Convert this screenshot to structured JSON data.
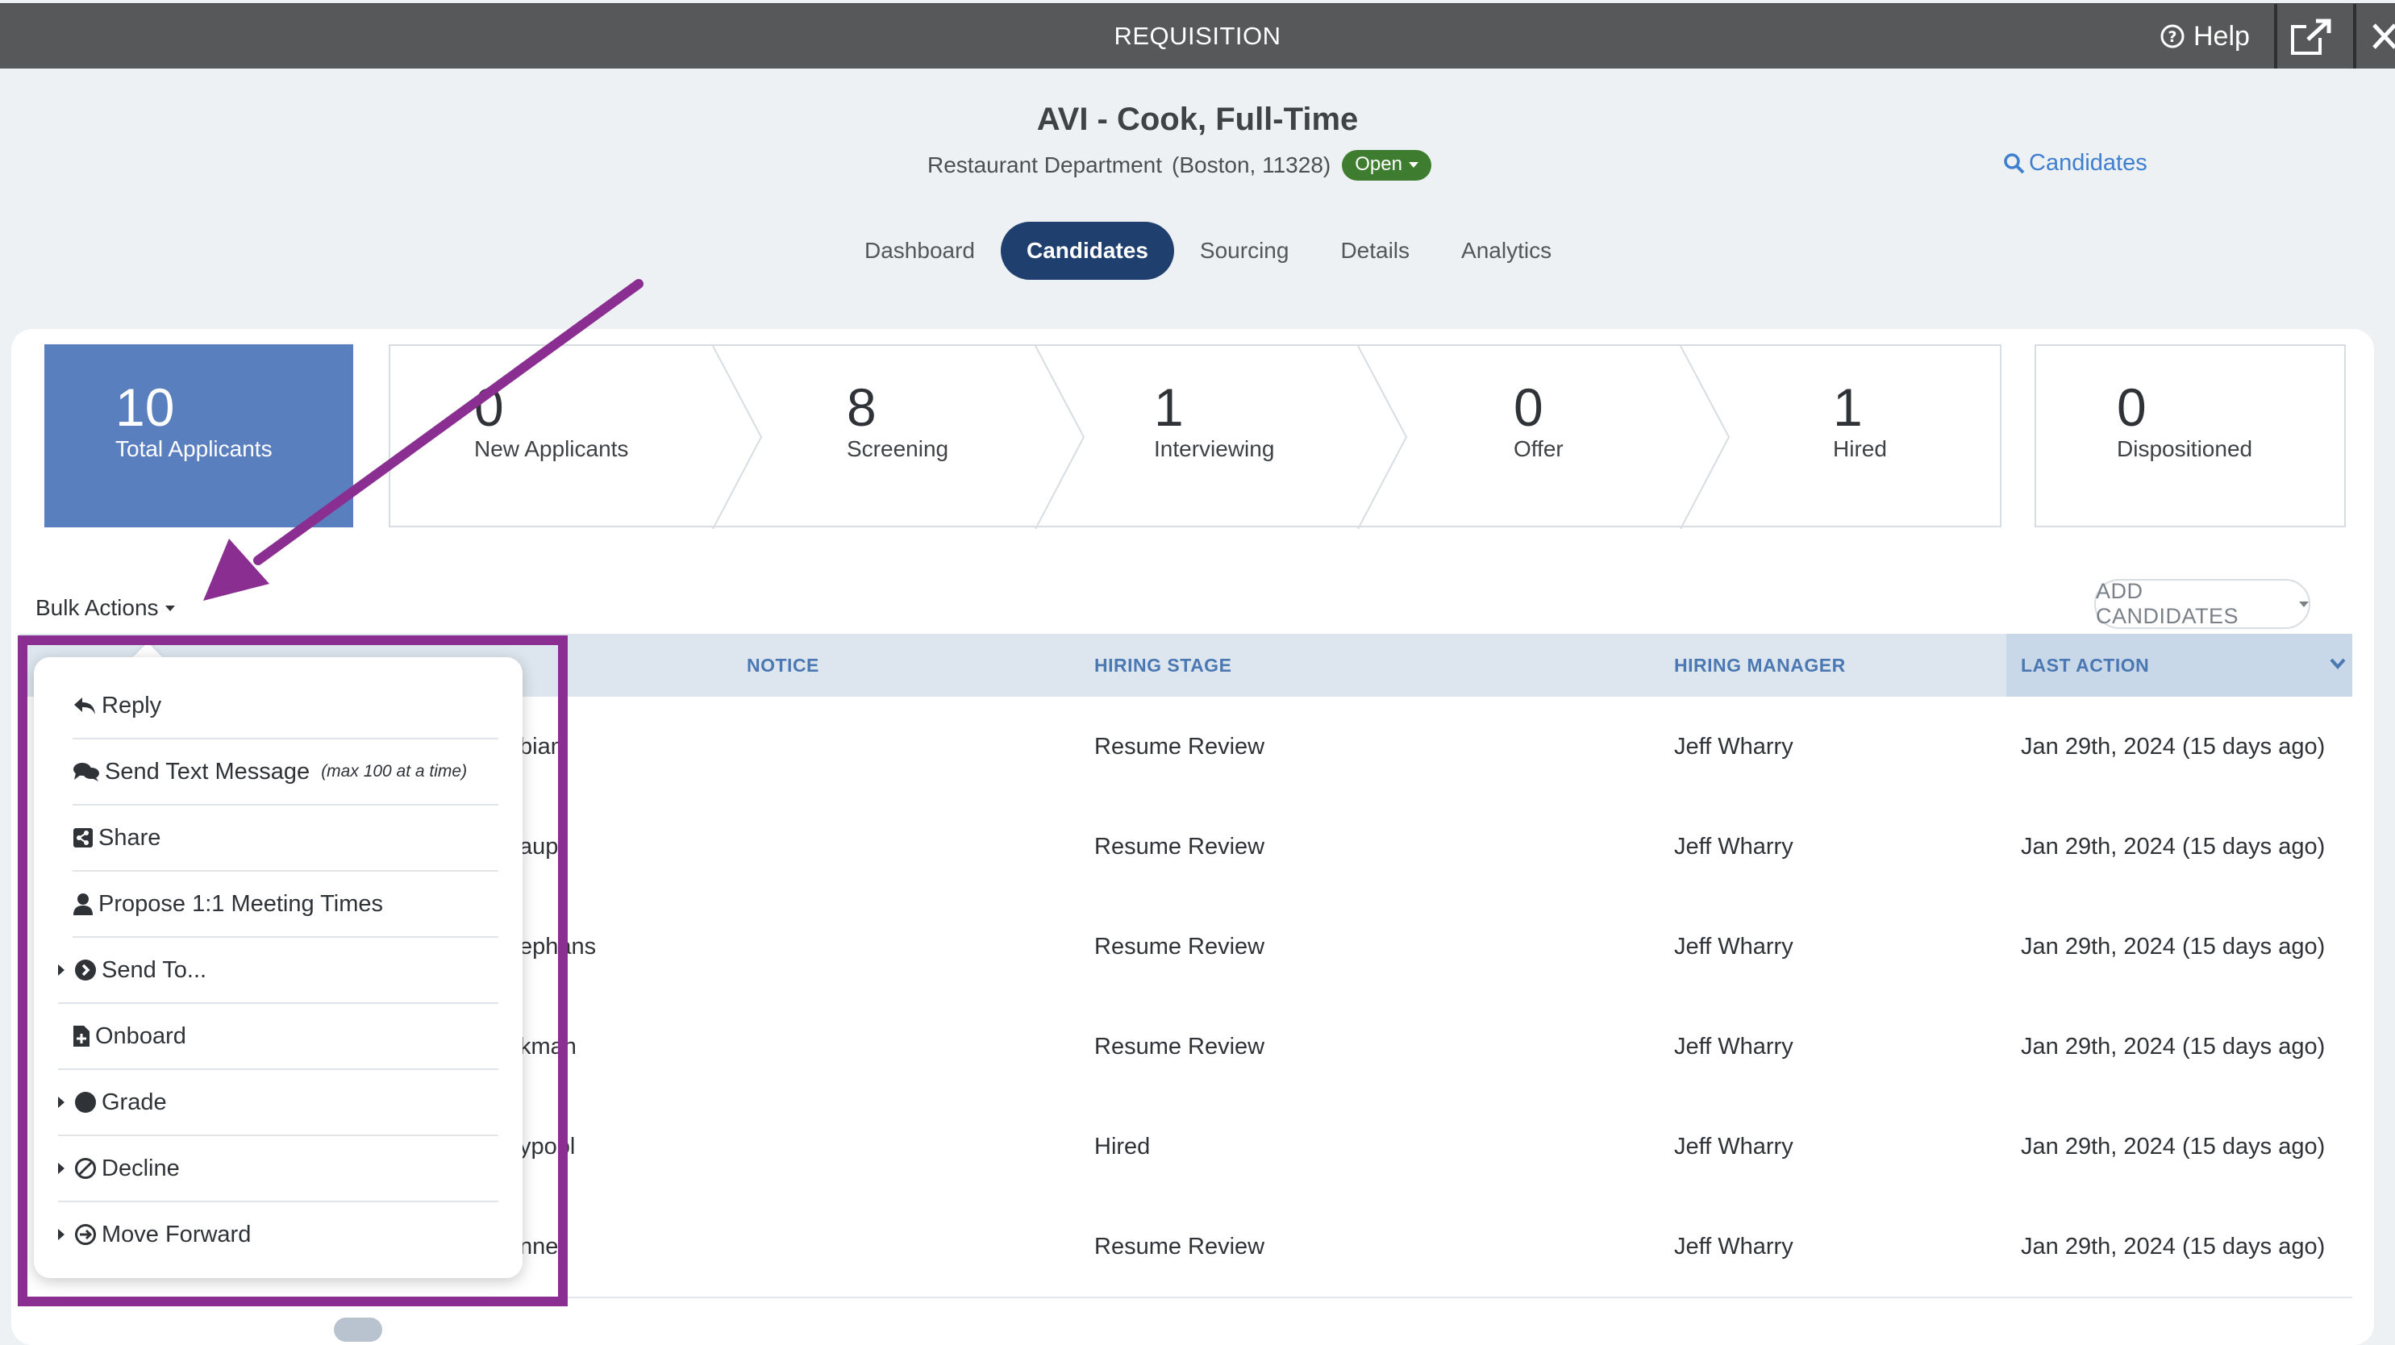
{
  "topbar": {
    "title": "REQUISITION",
    "help_label": "Help"
  },
  "requisition": {
    "title": "AVI - Cook, Full-Time",
    "department": "Restaurant Department",
    "location": "(Boston, 11328)",
    "status": "Open",
    "candidates_link": "Candidates"
  },
  "tabs": [
    {
      "label": "Dashboard",
      "active": false
    },
    {
      "label": "Candidates",
      "active": true
    },
    {
      "label": "Sourcing",
      "active": false
    },
    {
      "label": "Details",
      "active": false
    },
    {
      "label": "Analytics",
      "active": false
    }
  ],
  "summary": {
    "total": {
      "count": "10",
      "label": "Total Applicants"
    },
    "stages": [
      {
        "count": "0",
        "label": "New Applicants"
      },
      {
        "count": "8",
        "label": "Screening"
      },
      {
        "count": "1",
        "label": "Interviewing"
      },
      {
        "count": "0",
        "label": "Offer"
      },
      {
        "count": "1",
        "label": "Hired"
      }
    ],
    "dispositioned": {
      "count": "0",
      "label": "Dispositioned"
    }
  },
  "toolbar": {
    "bulk_actions_label": "Bulk Actions",
    "add_candidates_label": "ADD CANDIDATES"
  },
  "table": {
    "headers": {
      "notice": "NOTICE",
      "hiring_stage": "HIRING STAGE",
      "hiring_manager": "HIRING MANAGER",
      "last_action": "LAST ACTION"
    },
    "rows": [
      {
        "name_fragment": "bian",
        "stage": "Resume Review",
        "manager": "Jeff Wharry",
        "last_action": "Jan 29th, 2024 (15 days ago)"
      },
      {
        "name_fragment": "aupt",
        "stage": "Resume Review",
        "manager": "Jeff Wharry",
        "last_action": "Jan 29th, 2024 (15 days ago)"
      },
      {
        "name_fragment": "ephans",
        "stage": "Resume Review",
        "manager": "Jeff Wharry",
        "last_action": "Jan 29th, 2024 (15 days ago)"
      },
      {
        "name_fragment": "kman",
        "stage": "Resume Review",
        "manager": "Jeff Wharry",
        "last_action": "Jan 29th, 2024 (15 days ago)"
      },
      {
        "name_fragment": "ypool",
        "stage": "Hired",
        "manager": "Jeff Wharry",
        "last_action": "Jan 29th, 2024 (15 days ago)"
      },
      {
        "name_fragment": "nner",
        "stage": "Resume Review",
        "manager": "Jeff Wharry",
        "last_action": "Jan 29th, 2024 (15 days ago)"
      }
    ]
  },
  "bulk_menu": {
    "items": [
      {
        "label": "Reply",
        "icon": "reply-icon"
      },
      {
        "label": "Send Text Message",
        "note": "(max 100 at a time)",
        "icon": "chat-icon"
      },
      {
        "label": "Share",
        "icon": "share-icon"
      },
      {
        "label": "Propose 1:1 Meeting Times",
        "icon": "user-icon"
      },
      {
        "label": "Send To...",
        "icon": "arrow-circle-icon",
        "submenu": true
      },
      {
        "label": "Onboard",
        "icon": "file-plus-icon"
      },
      {
        "label": "Grade",
        "icon": "circle-icon",
        "submenu": true
      },
      {
        "label": "Decline",
        "icon": "ban-icon",
        "submenu": true
      },
      {
        "label": "Move Forward",
        "icon": "arrow-circle-right-icon",
        "submenu": true
      }
    ]
  },
  "annotation": {
    "color": "#8a2e91"
  },
  "colors": {
    "topbar": "#575859",
    "active_tab": "#1f3f6e",
    "total_box": "#5a7fbf",
    "status_open": "#3e7d2f",
    "link": "#3f7fcf"
  }
}
